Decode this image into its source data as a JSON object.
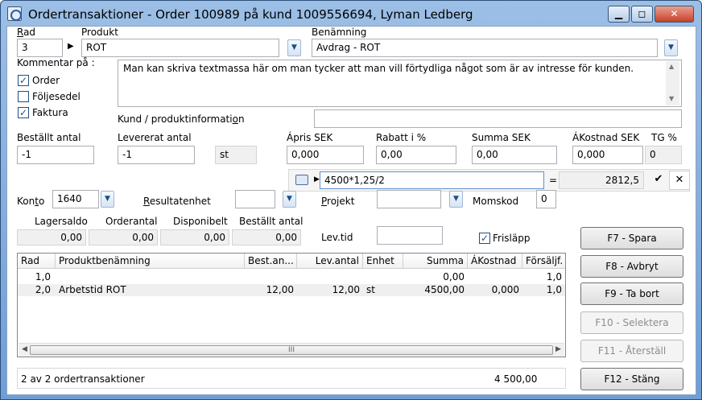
{
  "window": {
    "title": "Ordertransaktioner - Order 100989 på kund 1009556694, Lyman Ledberg",
    "min": "▁",
    "max": "◻",
    "close": "✕"
  },
  "form": {
    "rad_label": "Rad",
    "rad_value": "3",
    "produkt_label": "Produkt",
    "produkt_value": "ROT",
    "benamning_label": "Benämning",
    "benamning_value": "Avdrag - ROT",
    "kommentar_label": "Kommentar på :",
    "order_label": "Order",
    "foljesedel_label": "Följesedel",
    "faktura_label": "Faktura",
    "comment_text": "Man kan skriva textmassa här om man tycker att man vill förtydliga något som är av intresse för kunden.",
    "kund_info_label": "Kund / produktinformation",
    "kund_info_value": "",
    "bestallt_antal_label": "Beställt antal",
    "bestallt_antal_value": "-1",
    "levererat_antal_label": "Levererat antal",
    "levererat_antal_value": "-1",
    "unit": "st",
    "apris_label": "Ápris SEK",
    "apris_value": "0,000",
    "rabatt_label": "Rabatt i %",
    "rabatt_value": "0,00",
    "summa_label": "Summa SEK",
    "summa_value": "0,00",
    "akostnad_label": "ÁKostnad SEK",
    "akostnad_value": "0,000",
    "tg_label": "TG %",
    "tg_value": "0",
    "konto_label": "Konto",
    "konto_value": "1640",
    "resultatenhet_label": "Resultatenhet",
    "resultatenhet_value": "",
    "projekt_label": "Projekt",
    "projekt_value": "",
    "momskod_label": "Momskod",
    "momskod_value": "0",
    "lagersaldo_label": "Lagersaldo",
    "lagersaldo_value": "0,00",
    "orderantal_label": "Orderantal",
    "orderantal_value": "0,00",
    "disponibelt_label": "Disponibelt",
    "disponibelt_value": "0,00",
    "bestallt_antal2_label": "Beställt antal",
    "bestallt_antal2_value": "0,00",
    "levtid_label": "Lev.tid",
    "levtid_value": "",
    "frislapp_label": "Frisläpp"
  },
  "calc": {
    "expression": "4500*1,25/2",
    "equals": "=",
    "result": "2812,5",
    "ok": "✔",
    "cancel": "✕",
    "icon": "calculator-icon"
  },
  "grid": {
    "columns": [
      "Rad",
      "Produktbenämning",
      "Best.an...",
      "Lev.antal",
      "Enhet",
      "Summa",
      "ÁKostnad",
      "Försäljf."
    ],
    "rows": [
      [
        "1,0",
        "",
        "",
        "",
        "",
        "0,00",
        "",
        "1,0"
      ],
      [
        "2,0",
        "Arbetstid ROT",
        "12,00",
        "12,00",
        "st",
        "4500,00",
        "0,000",
        "1,0"
      ]
    ],
    "scroll_grip": "III"
  },
  "status": {
    "count_text": "2 av 2 ordertransaktioner",
    "total": "4 500,00"
  },
  "buttons": {
    "spara": "F7 - Spara",
    "avbryt": "F8 - Avbryt",
    "ta_bort": "F9 - Ta bort",
    "selektera": "F10 - Selektera",
    "aterstall": "F11 - Återställ",
    "stang": "F12 - Stäng"
  }
}
